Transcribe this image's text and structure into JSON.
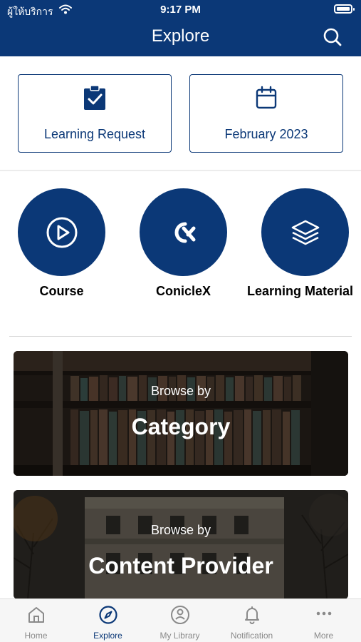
{
  "status_bar": {
    "carrier": "ผู้ให้บริการ",
    "time": "9:17 PM"
  },
  "header": {
    "title": "Explore"
  },
  "quick_cards": {
    "learning_request": "Learning Request",
    "calendar": "February 2023"
  },
  "categories": [
    {
      "label": "Course",
      "icon": "play-icon"
    },
    {
      "label": "ConicleX",
      "icon": "coniclex-logo-icon"
    },
    {
      "label": "Learning Material",
      "icon": "layers-icon"
    }
  ],
  "banners": [
    {
      "sub": "Browse by",
      "main": "Category"
    },
    {
      "sub": "Browse by",
      "main": "Content Provider"
    }
  ],
  "tabs": [
    {
      "label": "Home",
      "icon": "home-icon"
    },
    {
      "label": "Explore",
      "icon": "compass-icon",
      "active": true
    },
    {
      "label": "My Library",
      "icon": "library-icon"
    },
    {
      "label": "Notification",
      "icon": "bell-icon"
    },
    {
      "label": "More",
      "icon": "more-icon"
    }
  ],
  "colors": {
    "brand": "#0b3877",
    "inactive": "#8a8a8a"
  }
}
